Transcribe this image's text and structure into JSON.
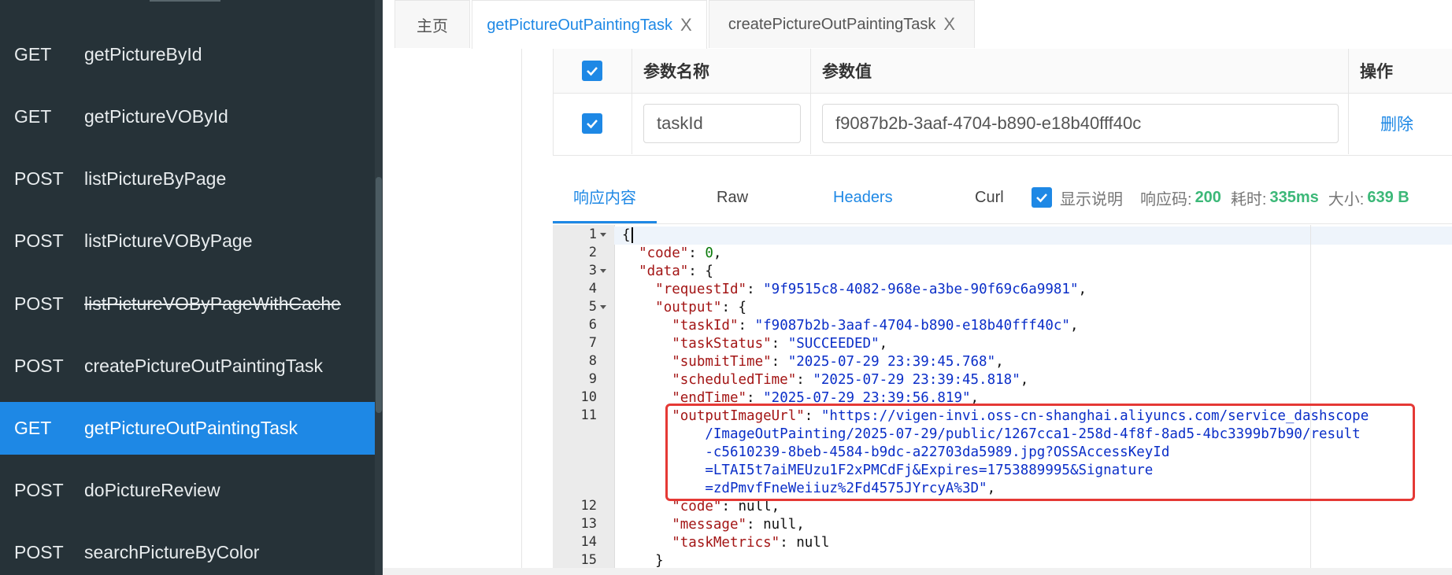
{
  "sidebar": {
    "items": [
      {
        "method": "GET",
        "name": "getPictureById",
        "active": false,
        "strike": false
      },
      {
        "method": "GET",
        "name": "getPictureVOById",
        "active": false,
        "strike": false
      },
      {
        "method": "POST",
        "name": "listPictureByPage",
        "active": false,
        "strike": false
      },
      {
        "method": "POST",
        "name": "listPictureVOByPage",
        "active": false,
        "strike": false
      },
      {
        "method": "POST",
        "name": "listPictureVOByPageWithCache",
        "active": false,
        "strike": true
      },
      {
        "method": "POST",
        "name": "createPictureOutPaintingTask",
        "active": false,
        "strike": false
      },
      {
        "method": "GET",
        "name": "getPictureOutPaintingTask",
        "active": true,
        "strike": false
      },
      {
        "method": "POST",
        "name": "doPictureReview",
        "active": false,
        "strike": false
      },
      {
        "method": "POST",
        "name": "searchPictureByColor",
        "active": false,
        "strike": false
      }
    ]
  },
  "tabs": [
    {
      "label": "主页",
      "closable": false
    },
    {
      "label": "getPictureOutPaintingTask",
      "closable": true,
      "active": true
    },
    {
      "label": "createPictureOutPaintingTask",
      "closable": true
    }
  ],
  "close_glyph": "X",
  "params": {
    "col_name": "参数名称",
    "col_value": "参数值",
    "col_action": "操作",
    "rows": [
      {
        "name": "taskId",
        "value": "f9087b2b-3aaf-4704-b890-e18b40fff40c",
        "action": "删除"
      }
    ]
  },
  "response": {
    "tab_content": "响应内容",
    "tab_raw": "Raw",
    "tab_headers": "Headers",
    "tab_curl": "Curl",
    "show_desc": "显示说明",
    "code_label": "响应码:",
    "code_value": "200",
    "time_label": "耗时:",
    "time_value": "335ms",
    "size_label": "大小:",
    "size_value": "639 B"
  },
  "json_lines": {
    "l1": "{",
    "l2_key": "\"code\"",
    "l2_val": "0",
    "l3_key": "\"data\"",
    "l4_key": "\"requestId\"",
    "l4_val": "\"9f9515c8-4082-968e-a3be-90f69c6a9981\"",
    "l5_key": "\"output\"",
    "l6_key": "\"taskId\"",
    "l6_val": "\"f9087b2b-3aaf-4704-b890-e18b40fff40c\"",
    "l7_key": "\"taskStatus\"",
    "l7_val": "\"SUCCEEDED\"",
    "l8_key": "\"submitTime\"",
    "l8_val": "\"2025-07-29 23:39:45.768\"",
    "l9_key": "\"scheduledTime\"",
    "l9_val": "\"2025-07-29 23:39:45.818\"",
    "l10_key": "\"endTime\"",
    "l10_val": "\"2025-07-29 23:39:56.819\"",
    "l11_key": "\"outputImageUrl\"",
    "l11_val_a": "\"https://vigen-invi.oss-cn-shanghai.aliyuncs.com/service_dashscope",
    "l11_val_b": "/ImageOutPainting/2025-07-29/public/1267cca1-258d-4f8f-8ad5-4bc3399b7b90/result",
    "l11_val_c": "-c5610239-8beb-4584-b9dc-a22703da5989.jpg?OSSAccessKeyId",
    "l11_val_d": "=LTAI5t7aiMEUzu1F2xPMCdFj&Expires=1753889995&Signature",
    "l11_val_e": "=zdPmvfFneWeiiuz%2Fd4575JYrcyA%3D\"",
    "l12_key": "\"code\"",
    "l12_val": "null",
    "l13_key": "\"message\"",
    "l13_val": "null",
    "l14_key": "\"taskMetrics\"",
    "l14_val": "null",
    "l15": "}"
  },
  "line_numbers": [
    "1",
    "2",
    "3",
    "4",
    "5",
    "6",
    "7",
    "8",
    "9",
    "10",
    "11",
    "12",
    "13",
    "14",
    "15"
  ],
  "colors": {
    "accent": "#1e88e5",
    "sidebar_bg": "#263238",
    "success": "#3cb878",
    "highlight_box": "#e53935"
  }
}
